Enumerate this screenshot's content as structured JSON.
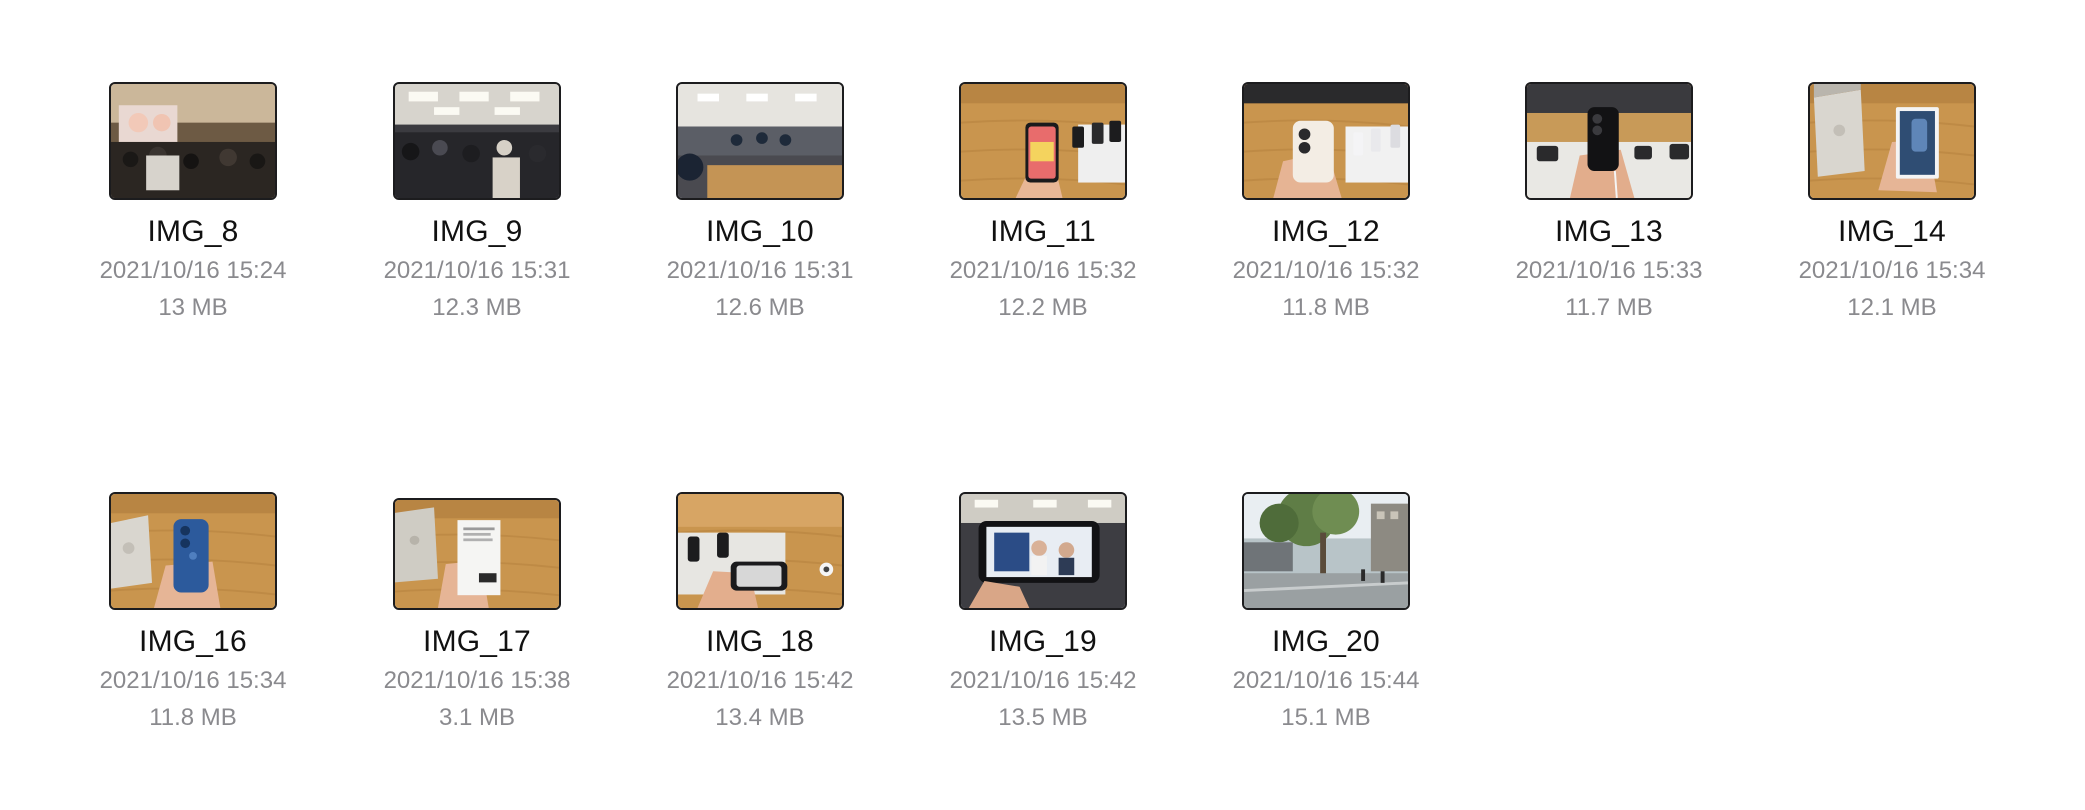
{
  "files": [
    {
      "name": "IMG_8",
      "date": "2021/10/16 15:24",
      "size": "13 MB",
      "thumb": "store-crowd-screen"
    },
    {
      "name": "IMG_9",
      "date": "2021/10/16 15:31",
      "size": "12.3 MB",
      "thumb": "store-crowd-ceiling"
    },
    {
      "name": "IMG_10",
      "date": "2021/10/16 15:31",
      "size": "12.6 MB",
      "thumb": "store-interior-tables"
    },
    {
      "name": "IMG_11",
      "date": "2021/10/16 15:32",
      "size": "12.2 MB",
      "thumb": "hand-phone-front-table"
    },
    {
      "name": "IMG_12",
      "date": "2021/10/16 15:32",
      "size": "11.8 MB",
      "thumb": "hand-phone-back-white"
    },
    {
      "name": "IMG_13",
      "date": "2021/10/16 15:33",
      "size": "11.7 MB",
      "thumb": "hand-phone-back-black"
    },
    {
      "name": "IMG_14",
      "date": "2021/10/16 15:34",
      "size": "12.1 MB",
      "thumb": "phone-box-table"
    },
    {
      "name": "IMG_16",
      "date": "2021/10/16 15:34",
      "size": "11.8 MB",
      "thumb": "hand-phone-back-blue"
    },
    {
      "name": "IMG_17",
      "date": "2021/10/16 15:38",
      "size": "3.1 MB",
      "thumb": "hand-box-back"
    },
    {
      "name": "IMG_18",
      "date": "2021/10/16 15:42",
      "size": "13.4 MB",
      "thumb": "hand-phone-landscape-table"
    },
    {
      "name": "IMG_19",
      "date": "2021/10/16 15:42",
      "size": "13.5 MB",
      "thumb": "phone-camera-store"
    },
    {
      "name": "IMG_20",
      "date": "2021/10/16 15:44",
      "size": "15.1 MB",
      "thumb": "outdoor-plaza-tree"
    }
  ]
}
